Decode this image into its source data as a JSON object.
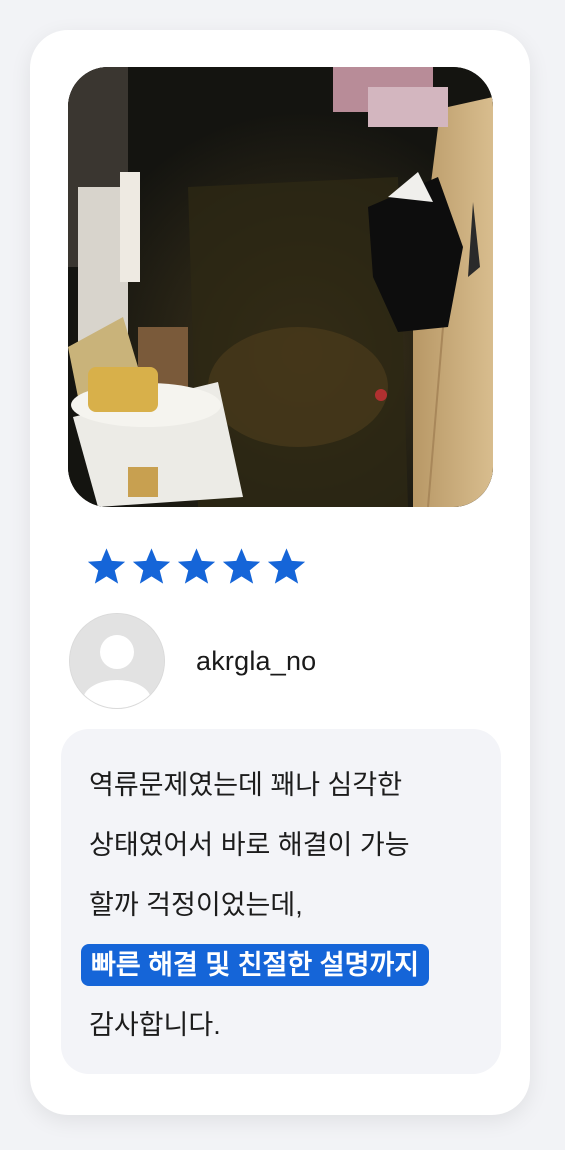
{
  "review": {
    "rating": 5,
    "rating_max": 5,
    "star_color": "#1565d8",
    "username": "akrgla_no",
    "text_lines": [
      "역류문제였는데 꽤나 심각한",
      "상태였어서 바로 해결이 가능",
      "할까 걱정이었는데,"
    ],
    "highlight": "빠른 해결 및 친절한 설명까지",
    "closing": "감사합니다."
  },
  "photo": {
    "icon": "review-photo"
  },
  "avatar": {
    "icon": "default-avatar-icon"
  }
}
